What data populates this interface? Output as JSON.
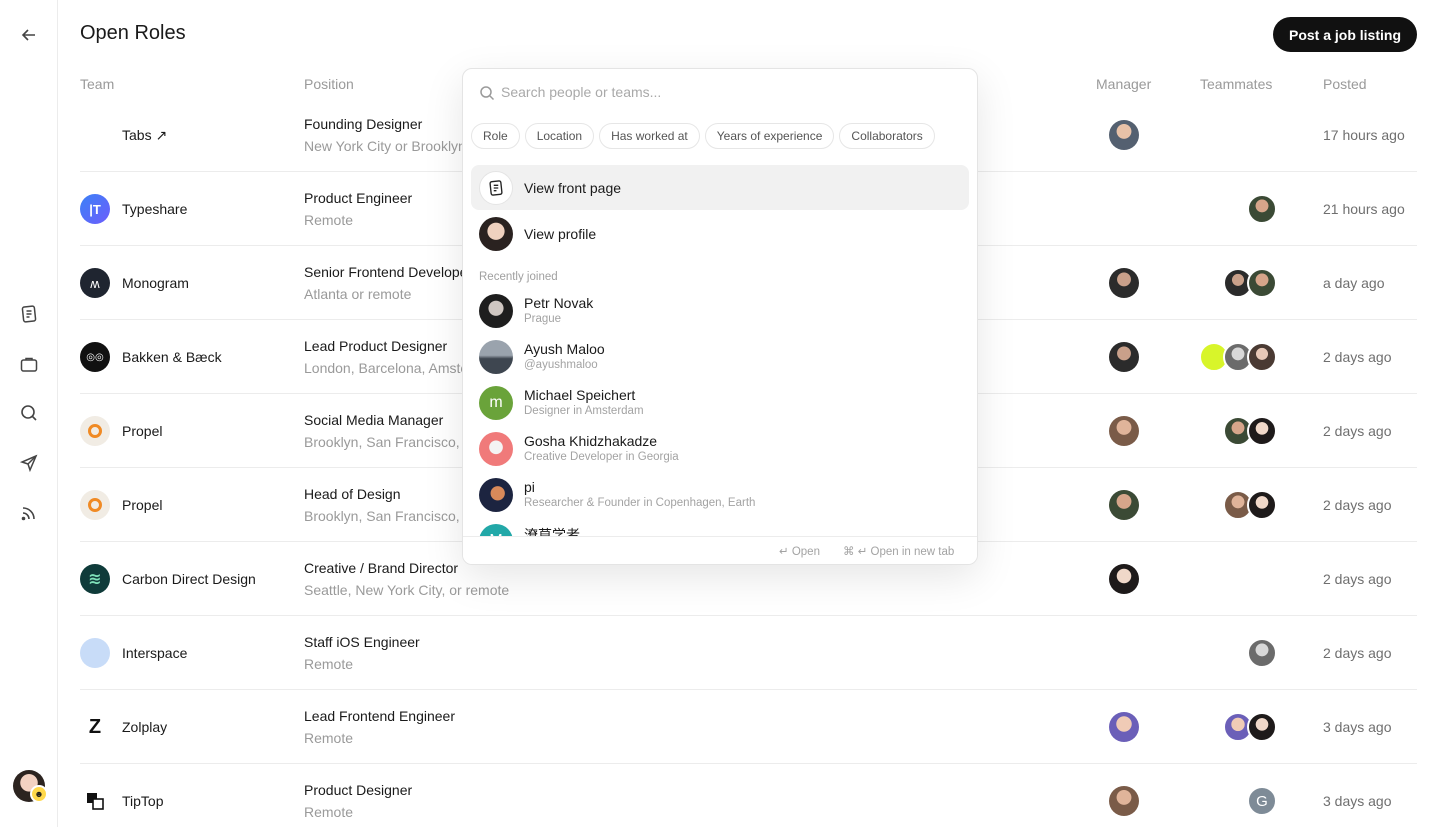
{
  "page": {
    "title": "Open Roles",
    "post_button": "Post a job listing"
  },
  "columns": {
    "team": "Team",
    "position": "Position",
    "manager": "Manager",
    "teammates": "Teammates",
    "posted": "Posted"
  },
  "sidebar": {
    "icons": [
      "back-arrow-icon",
      "document-icon",
      "briefcase-icon",
      "search-icon",
      "send-icon",
      "rss-icon"
    ]
  },
  "rows": [
    {
      "team": "Tabs ↗",
      "title": "Founding Designer",
      "location": "New York City or Brooklyn",
      "posted": "17 hours ago",
      "logo_color": "#ffffff",
      "logo_text": ""
    },
    {
      "team": "Typeshare",
      "title": "Product Engineer",
      "location": "Remote",
      "posted": "21 hours ago",
      "logo_color": "#4f6ef7",
      "logo_text": "|T"
    },
    {
      "team": "Monogram",
      "title": "Senior Frontend Developer",
      "location": "Atlanta or remote",
      "posted": "a day ago",
      "logo_color": "#1f2530",
      "logo_text": "ʍ"
    },
    {
      "team": "Bakken & Bæck",
      "title": "Lead Product Designer",
      "location": "London, Barcelona, Amsterdam",
      "posted": "2 days ago",
      "logo_color": "#111111",
      "logo_text": "◎◎"
    },
    {
      "team": "Propel",
      "title": "Social Media Manager",
      "location": "Brooklyn, San Francisco, or remote",
      "posted": "2 days ago",
      "logo_color": "#f1ece4",
      "logo_text": ""
    },
    {
      "team": "Propel",
      "title": "Head of Design",
      "location": "Brooklyn, San Francisco, or remote",
      "posted": "2 days ago",
      "logo_color": "#f1ece4",
      "logo_text": ""
    },
    {
      "team": "Carbon Direct Design",
      "title": "Creative / Brand Director",
      "location": "Seattle, New York City, or remote",
      "posted": "2 days ago",
      "logo_color": "#0f3b3a",
      "logo_text": "≋"
    },
    {
      "team": "Interspace",
      "title": "Staff iOS Engineer",
      "location": "Remote",
      "posted": "2 days ago",
      "logo_color": "#c8dcf8",
      "logo_text": ""
    },
    {
      "team": "Zolplay",
      "title": "Lead Frontend Engineer",
      "location": "Remote",
      "posted": "3 days ago",
      "logo_color": "#ffffff",
      "logo_text": "Z"
    },
    {
      "team": "TipTop",
      "title": "Product Designer",
      "location": "Remote",
      "posted": "3 days ago",
      "logo_color": "#ffffff",
      "logo_text": ""
    }
  ],
  "palette": {
    "placeholder": "Search people or teams...",
    "filters": [
      "Role",
      "Location",
      "Has worked at",
      "Years of experience",
      "Collaborators"
    ],
    "actions": [
      {
        "label": "View front page",
        "icon": "document-icon"
      },
      {
        "label": "View profile",
        "icon": "avatar"
      }
    ],
    "section_label": "Recently joined",
    "people": [
      {
        "name": "Petr Novak",
        "sub": "Prague",
        "initial": "",
        "color": "#1e1e1e"
      },
      {
        "name": "Ayush Maloo",
        "sub": "@ayushmaloo",
        "initial": "",
        "color": "#59636f"
      },
      {
        "name": "Michael Speichert",
        "sub": "Designer in Amsterdam",
        "initial": "m",
        "color": "#6aa33a"
      },
      {
        "name": "Gosha Khidzhakadze",
        "sub": "Creative Developer in Georgia",
        "initial": "",
        "color": "#f07a7a"
      },
      {
        "name": "pi",
        "sub": "Researcher & Founder in Copenhagen, Earth",
        "initial": "",
        "color": "#1c2440"
      },
      {
        "name": "潦草学者",
        "sub": "",
        "initial": "M",
        "color": "#22a8a8"
      }
    ],
    "footer": {
      "open": "↵  Open",
      "open_new_tab": "⌘ ↵  Open in new tab"
    }
  }
}
